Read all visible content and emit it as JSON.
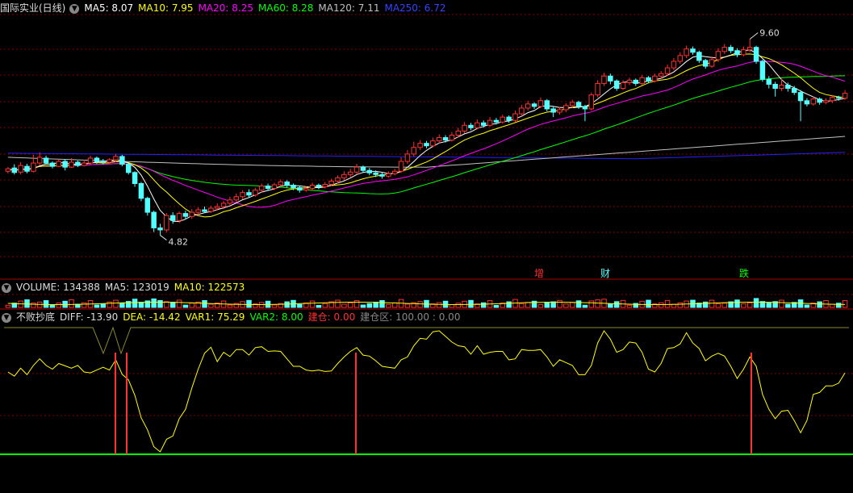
{
  "main_header": {
    "title": "国际实业(日线)",
    "ma5": "MA5: 8.07",
    "ma10": "MA10: 7.95",
    "ma20": "MA20: 8.25",
    "ma60": "MA60: 8.28",
    "ma120": "MA120: 7.11",
    "ma250": "MA250: 6.72"
  },
  "price_labels": {
    "high": "9.60",
    "low": "4.82"
  },
  "tags": {
    "zeng": "增",
    "cai": "财",
    "die": "跌"
  },
  "volume_header": {
    "name": "VOLUME: 134388",
    "ma5": "MA5: 123019",
    "ma10": "MA10: 122573"
  },
  "indicator_header": {
    "name": "不败抄底",
    "diff": "DIFF: -13.90",
    "dea": "DEA: -14.42",
    "var1": "VAR1: 75.29",
    "var2": "VAR2: 8.00",
    "jiancang": "建仓: 0.00",
    "jiancangqu": "建仓区: 100.00 : 0.00"
  },
  "colors": {
    "background": "#000000",
    "up": "#ff3232",
    "down": "#54ffff",
    "ma5": "#ffffff",
    "ma10": "#ffff00",
    "ma20": "#ff00ff",
    "ma60": "#00ff00",
    "ma120": "#c0c0c0",
    "ma250": "#2222ff",
    "grid": "#800000",
    "separator": "#b00000"
  },
  "icons": {
    "collapse": "chevron-down-icon"
  },
  "chart_data": {
    "type": "candlestick",
    "title": "国际实业(日线)",
    "price_range": [
      4.3,
      10.2
    ],
    "high_marker": 9.6,
    "low_marker": 4.82,
    "candles": [
      [
        6.38,
        6.44,
        6.33,
        6.48
      ],
      [
        6.46,
        6.35,
        6.3,
        6.55
      ],
      [
        6.36,
        6.52,
        6.3,
        6.6
      ],
      [
        6.5,
        6.38,
        6.33,
        6.56
      ],
      [
        6.38,
        6.58,
        6.35,
        6.78
      ],
      [
        6.58,
        6.72,
        6.52,
        6.84
      ],
      [
        6.7,
        6.58,
        6.55,
        6.76
      ],
      [
        6.58,
        6.5,
        6.45,
        6.62
      ],
      [
        6.5,
        6.62,
        6.48,
        6.66
      ],
      [
        6.62,
        6.48,
        6.4,
        6.68
      ],
      [
        6.48,
        6.6,
        6.46,
        6.7
      ],
      [
        6.6,
        6.52,
        6.48,
        6.64
      ],
      [
        6.52,
        6.58,
        6.5,
        6.66
      ],
      [
        6.58,
        6.7,
        6.54,
        6.76
      ],
      [
        6.7,
        6.62,
        6.56,
        6.74
      ],
      [
        6.62,
        6.6,
        6.55,
        6.68
      ],
      [
        6.6,
        6.66,
        6.56,
        6.7
      ],
      [
        6.66,
        6.74,
        6.6,
        6.8
      ],
      [
        6.74,
        6.55,
        6.5,
        6.78
      ],
      [
        6.55,
        6.35,
        6.3,
        6.58
      ],
      [
        6.35,
        6.08,
        6.0,
        6.38
      ],
      [
        6.08,
        5.72,
        5.65,
        6.12
      ],
      [
        5.72,
        5.38,
        5.3,
        5.76
      ],
      [
        5.38,
        5.0,
        4.9,
        5.42
      ],
      [
        5.0,
        4.95,
        4.82,
        5.1
      ],
      [
        4.95,
        5.3,
        4.9,
        5.36
      ],
      [
        5.3,
        5.18,
        5.1,
        5.38
      ],
      [
        5.18,
        5.35,
        5.12,
        5.4
      ],
      [
        5.35,
        5.28,
        5.2,
        5.42
      ],
      [
        5.28,
        5.38,
        5.22,
        5.46
      ],
      [
        5.38,
        5.44,
        5.3,
        5.5
      ],
      [
        5.44,
        5.4,
        5.36,
        5.52
      ],
      [
        5.4,
        5.48,
        5.36,
        5.54
      ],
      [
        5.48,
        5.52,
        5.42,
        5.6
      ],
      [
        5.52,
        5.6,
        5.46,
        5.66
      ],
      [
        5.6,
        5.68,
        5.54,
        5.76
      ],
      [
        5.68,
        5.76,
        5.62,
        5.84
      ],
      [
        5.76,
        5.86,
        5.7,
        5.92
      ],
      [
        5.86,
        5.8,
        5.74,
        5.94
      ],
      [
        5.8,
        5.92,
        5.76,
        5.98
      ],
      [
        5.92,
        6.02,
        5.86,
        6.08
      ],
      [
        6.02,
        5.96,
        5.9,
        6.08
      ],
      [
        5.96,
        6.05,
        5.92,
        6.1
      ],
      [
        6.05,
        6.12,
        6.0,
        6.18
      ],
      [
        6.12,
        6.04,
        5.98,
        6.16
      ],
      [
        6.04,
        5.98,
        5.92,
        6.08
      ],
      [
        5.98,
        5.92,
        5.86,
        6.02
      ],
      [
        5.92,
        5.96,
        5.88,
        6.02
      ],
      [
        5.96,
        6.04,
        5.92,
        6.1
      ],
      [
        6.04,
        6.0,
        5.94,
        6.08
      ],
      [
        6.0,
        6.06,
        5.96,
        6.12
      ],
      [
        6.06,
        6.14,
        6.02,
        6.2
      ],
      [
        6.14,
        6.22,
        6.08,
        6.28
      ],
      [
        6.22,
        6.3,
        6.16,
        6.38
      ],
      [
        6.3,
        6.36,
        6.24,
        6.44
      ],
      [
        6.36,
        6.48,
        6.3,
        6.56
      ],
      [
        6.48,
        6.4,
        6.34,
        6.52
      ],
      [
        6.4,
        6.34,
        6.28,
        6.46
      ],
      [
        6.34,
        6.3,
        6.24,
        6.4
      ],
      [
        6.3,
        6.26,
        6.2,
        6.36
      ],
      [
        6.26,
        6.32,
        6.22,
        6.38
      ],
      [
        6.32,
        6.38,
        6.28,
        6.44
      ],
      [
        6.38,
        6.62,
        6.34,
        6.72
      ],
      [
        6.62,
        6.8,
        6.56,
        6.9
      ],
      [
        6.8,
        6.96,
        6.74,
        7.1
      ],
      [
        6.96,
        7.06,
        6.9,
        7.14
      ],
      [
        7.06,
        7.0,
        6.94,
        7.12
      ],
      [
        7.0,
        7.12,
        6.96,
        7.2
      ],
      [
        7.12,
        7.2,
        7.06,
        7.28
      ],
      [
        7.2,
        7.14,
        7.08,
        7.26
      ],
      [
        7.14,
        7.26,
        7.1,
        7.34
      ],
      [
        7.26,
        7.36,
        7.2,
        7.44
      ],
      [
        7.36,
        7.5,
        7.3,
        7.58
      ],
      [
        7.5,
        7.44,
        7.38,
        7.56
      ],
      [
        7.44,
        7.56,
        7.4,
        7.64
      ],
      [
        7.56,
        7.5,
        7.44,
        7.62
      ],
      [
        7.5,
        7.62,
        7.46,
        7.7
      ],
      [
        7.62,
        7.58,
        7.52,
        7.68
      ],
      [
        7.58,
        7.7,
        7.54,
        7.76
      ],
      [
        7.7,
        7.62,
        7.56,
        7.74
      ],
      [
        7.62,
        7.78,
        7.58,
        7.86
      ],
      [
        7.78,
        7.92,
        7.72,
        8.0
      ],
      [
        7.92,
        8.02,
        7.86,
        8.1
      ],
      [
        8.02,
        7.96,
        7.9,
        8.06
      ],
      [
        7.96,
        8.1,
        7.92,
        8.18
      ],
      [
        8.1,
        7.9,
        7.84,
        8.14
      ],
      [
        7.9,
        7.82,
        7.7,
        7.96
      ],
      [
        7.82,
        7.88,
        7.76,
        7.94
      ],
      [
        7.88,
        7.98,
        7.82,
        8.04
      ],
      [
        7.98,
        8.06,
        7.92,
        8.12
      ],
      [
        8.06,
        7.96,
        7.9,
        8.1
      ],
      [
        7.96,
        7.9,
        7.6,
        8.0
      ],
      [
        7.9,
        8.24,
        7.86,
        8.3
      ],
      [
        8.24,
        8.52,
        8.18,
        8.6
      ],
      [
        8.52,
        8.7,
        8.46,
        8.78
      ],
      [
        8.7,
        8.58,
        8.5,
        8.76
      ],
      [
        8.58,
        8.4,
        8.34,
        8.62
      ],
      [
        8.4,
        8.54,
        8.36,
        8.6
      ],
      [
        8.54,
        8.6,
        8.48,
        8.66
      ],
      [
        8.6,
        8.52,
        8.46,
        8.64
      ],
      [
        8.52,
        8.66,
        8.48,
        8.72
      ],
      [
        8.66,
        8.58,
        8.52,
        8.7
      ],
      [
        8.58,
        8.7,
        8.54,
        8.76
      ],
      [
        8.7,
        8.76,
        8.64,
        8.82
      ],
      [
        8.76,
        8.9,
        8.7,
        8.98
      ],
      [
        8.9,
        9.06,
        8.84,
        9.14
      ],
      [
        9.06,
        9.2,
        9.0,
        9.28
      ],
      [
        9.2,
        9.36,
        9.14,
        9.44
      ],
      [
        9.36,
        9.28,
        9.22,
        9.42
      ],
      [
        9.28,
        9.08,
        9.02,
        9.32
      ],
      [
        9.08,
        8.94,
        8.88,
        9.12
      ],
      [
        8.94,
        9.1,
        8.9,
        9.18
      ],
      [
        9.1,
        9.3,
        9.04,
        9.38
      ],
      [
        9.3,
        9.4,
        9.24,
        9.48
      ],
      [
        9.4,
        9.32,
        9.26,
        9.46
      ],
      [
        9.32,
        9.22,
        9.16,
        9.38
      ],
      [
        9.22,
        9.34,
        9.18,
        9.42
      ],
      [
        9.34,
        9.4,
        9.28,
        9.6
      ],
      [
        9.4,
        9.06,
        9.0,
        9.44
      ],
      [
        9.06,
        8.62,
        8.56,
        9.1
      ],
      [
        8.62,
        8.5,
        8.4,
        8.7
      ],
      [
        8.5,
        8.4,
        8.2,
        8.56
      ],
      [
        8.4,
        8.48,
        8.34,
        8.64
      ],
      [
        8.48,
        8.4,
        8.32,
        8.54
      ],
      [
        8.4,
        8.3,
        8.24,
        8.46
      ],
      [
        8.3,
        8.1,
        7.6,
        8.36
      ],
      [
        8.1,
        8.02,
        7.96,
        8.16
      ],
      [
        8.02,
        8.14,
        7.98,
        8.2
      ],
      [
        8.14,
        8.06,
        8.0,
        8.18
      ],
      [
        8.06,
        8.1,
        8.02,
        8.16
      ],
      [
        8.1,
        8.18,
        8.04,
        8.24
      ],
      [
        8.18,
        8.16,
        8.1,
        8.22
      ],
      [
        8.16,
        8.28,
        8.12,
        8.36
      ]
    ]
  }
}
